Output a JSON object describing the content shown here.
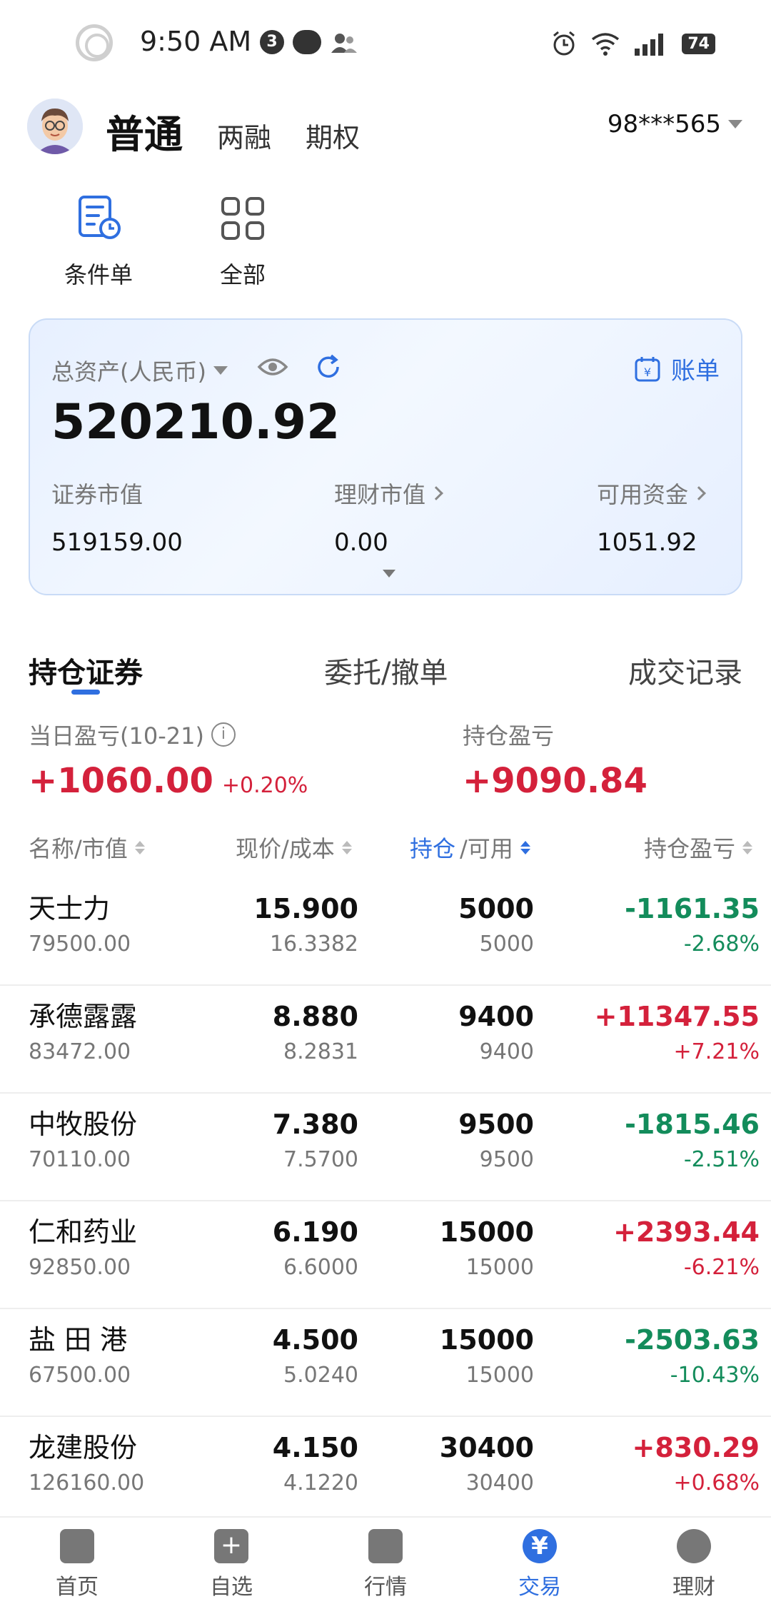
{
  "status_bar": {
    "time": "9:50 AM",
    "notification_count": "3",
    "battery": "74"
  },
  "header": {
    "active_tab": "普通",
    "tabs": [
      "两融",
      "期权"
    ],
    "account": "98***565"
  },
  "quick_actions": [
    {
      "label": "条件单",
      "icon": "conditional-order-icon"
    },
    {
      "label": "全部",
      "icon": "grid-icon"
    }
  ],
  "asset_card": {
    "total_label": "总资产(人民币)",
    "bill_label": "账单",
    "total_value": "520210.92",
    "securities_label": "证券市值",
    "securities_value": "519159.00",
    "wealth_label": "理财市值",
    "wealth_value": "0.00",
    "cash_label": "可用资金",
    "cash_value": "1051.92"
  },
  "tabs": [
    "持仓证券",
    "委托/撤单",
    "成交记录"
  ],
  "pnl": {
    "daily_label": "当日盈亏(10-21)",
    "daily_value": "+1060.00",
    "daily_pct": "+0.20%",
    "holding_label": "持仓盈亏",
    "holding_value": "+9090.84"
  },
  "table": {
    "headers": [
      "名称/市值",
      "现价/成本",
      "持仓",
      "/可用",
      "持仓盈亏"
    ],
    "rows": [
      {
        "name": "天士力",
        "mv": "79500.00",
        "price": "15.900",
        "cost": "16.3382",
        "qty": "5000",
        "avail": "5000",
        "pl": "-1161.35",
        "pl_pct": "-2.68%",
        "pl_dir": "down",
        "pct_dir": "down"
      },
      {
        "name": "承德露露",
        "mv": "83472.00",
        "price": "8.880",
        "cost": "8.2831",
        "qty": "9400",
        "avail": "9400",
        "pl": "+11347.55",
        "pl_pct": "+7.21%",
        "pl_dir": "up",
        "pct_dir": "up"
      },
      {
        "name": "中牧股份",
        "mv": "70110.00",
        "price": "7.380",
        "cost": "7.5700",
        "qty": "9500",
        "avail": "9500",
        "pl": "-1815.46",
        "pl_pct": "-2.51%",
        "pl_dir": "down",
        "pct_dir": "down"
      },
      {
        "name": "仁和药业",
        "mv": "92850.00",
        "price": "6.190",
        "cost": "6.6000",
        "qty": "15000",
        "avail": "15000",
        "pl": "+2393.44",
        "pl_pct": "-6.21%",
        "pl_dir": "up",
        "pct_dir": "up"
      },
      {
        "name": "盐 田 港",
        "mv": "67500.00",
        "price": "4.500",
        "cost": "5.0240",
        "qty": "15000",
        "avail": "15000",
        "pl": "-2503.63",
        "pl_pct": "-10.43%",
        "pl_dir": "down",
        "pct_dir": "down"
      },
      {
        "name": "龙建股份",
        "mv": "126160.00",
        "price": "4.150",
        "cost": "4.1220",
        "qty": "30400",
        "avail": "30400",
        "pl": "+830.29",
        "pl_pct": "+0.68%",
        "pl_dir": "up",
        "pct_dir": "up"
      }
    ]
  },
  "bottom_nav": [
    {
      "label": "首页",
      "icon": "home-icon"
    },
    {
      "label": "自选",
      "icon": "plus-icon"
    },
    {
      "label": "行情",
      "icon": "chart-icon"
    },
    {
      "label": "交易",
      "icon": "yuan-icon",
      "glyph": "¥"
    },
    {
      "label": "理财",
      "icon": "diamond-icon"
    }
  ],
  "colors": {
    "accent": "#2f6fe0",
    "up": "#d4213b",
    "down": "#138c5b"
  }
}
